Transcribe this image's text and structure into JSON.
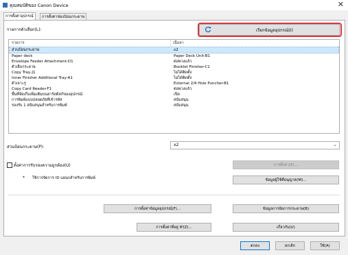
{
  "window": {
    "title": "คุณสมบัติของ Canon Device",
    "close_glyph": "✕"
  },
  "tabs": [
    {
      "label": "การตั้งค่าอุปกรณ์"
    },
    {
      "label": "การตั้งค่าช่องป้อนกระดาษ"
    }
  ],
  "device_list": {
    "label": "รายการตัวเลือก(L):",
    "columns": [
      "รายการ",
      "เนื้อหา"
    ],
    "rows": [
      {
        "item": "ส่วนป้อนกระดาษ",
        "content": "x2"
      },
      {
        "item": "Paper deck",
        "content": "Paper Deck Unit-B1"
      },
      {
        "item": "Envelope Feeder Attachment-D1",
        "content": "ต่อพ่วงแล้ว"
      },
      {
        "item": "ตัวเย็บกระดาษ",
        "content": "Booklet Finisher-C1"
      },
      {
        "item": "Copy Tray-J1",
        "content": "ไม่ได้ติดตั้ง"
      },
      {
        "item": "Inner Finisher Additional Tray-A1",
        "content": "ไม่ได้ติดตั้ง"
      },
      {
        "item": "ตัวเจาะรู",
        "content": "External 2/4 Hole Puncher-B1"
      },
      {
        "item": "Copy Card Reader-F1",
        "content": "ต่อพ่วงแล้ว"
      },
      {
        "item": "พื้นที่จัดเก็บเพิ่มเติมบนฮาร์ดดิสก์ของอุปกรณ์",
        "content": "เปิด"
      },
      {
        "item": "การพิมพ์แบบปลอดภัยที่เข้ารหัส",
        "content": "สนับสนุน"
      },
      {
        "item": "รองรับ 1 สนับสนุนสำหรับการพิมพ์",
        "content": "สนับสนุน"
      }
    ]
  },
  "installed_options": {
    "label": "ส่วนป้อนกระดาษ(P):",
    "value": "x2"
  },
  "auth": {
    "checkbox_label": "ตั้งค่าการรับรองความถูกต้อง(U)",
    "settings_button": "การตั้งค่า(E)...",
    "bullet": "*",
    "dept_label": "ใช้การจัดการ ID แผนกสำหรับการพิมพ์",
    "permissions_button": "ข้อมูลผู้ใช้ที่อนุญาต(M)..."
  },
  "buttons": {
    "retrieve": "เรียกข้อมูลอุปกรณ์(I)",
    "set_device_info": "การตั้งค่าข้อมูลอุปกรณ์(F)...",
    "color_management": "ข้อมูลการจัดการกระดาษ(B)",
    "ip_settings": "การตั้งค่าที่อยู่ IP(Z)...",
    "about": "เกี่ยวกับ(U)",
    "ok": "ตกลง",
    "cancel": "ยกเลิก",
    "apply": "ใช้(A)"
  },
  "colors": {
    "accent_highlight": "#d9363e",
    "selection": "#cce8ff",
    "refresh_icon": "#2b6cc4"
  },
  "icons": {
    "refresh": "refresh-icon",
    "dropdown": "chevron-down-icon"
  }
}
